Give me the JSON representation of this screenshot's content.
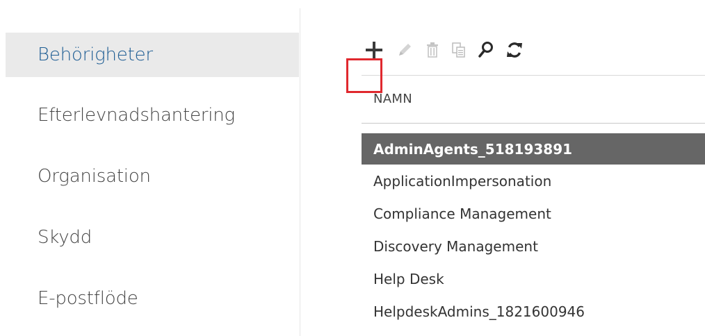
{
  "sidebar": {
    "items": [
      {
        "label": "Behörigheter",
        "selected": true
      },
      {
        "label": "Efterlevnadshantering",
        "selected": false
      },
      {
        "label": "Organisation",
        "selected": false
      },
      {
        "label": "Skydd",
        "selected": false
      },
      {
        "label": "E-postflöde",
        "selected": false
      }
    ]
  },
  "toolbar": {
    "icons": [
      "plus-icon",
      "pencil-icon",
      "trash-icon",
      "copy-icon",
      "search-icon",
      "refresh-icon"
    ]
  },
  "table": {
    "column_header": "NAMN",
    "rows": [
      {
        "name": "AdminAgents_518193891",
        "selected": true
      },
      {
        "name": "ApplicationImpersonation",
        "selected": false
      },
      {
        "name": "Compliance Management",
        "selected": false
      },
      {
        "name": "Discovery Management",
        "selected": false
      },
      {
        "name": "Help Desk",
        "selected": false
      },
      {
        "name": "HelpdeskAdmins_1821600946",
        "selected": false
      }
    ]
  },
  "colors": {
    "selected_nav_text": "#1f5e94",
    "selected_nav_bg": "#eaeaea",
    "selected_row_bg": "#666666",
    "highlight": "#e0282e"
  }
}
